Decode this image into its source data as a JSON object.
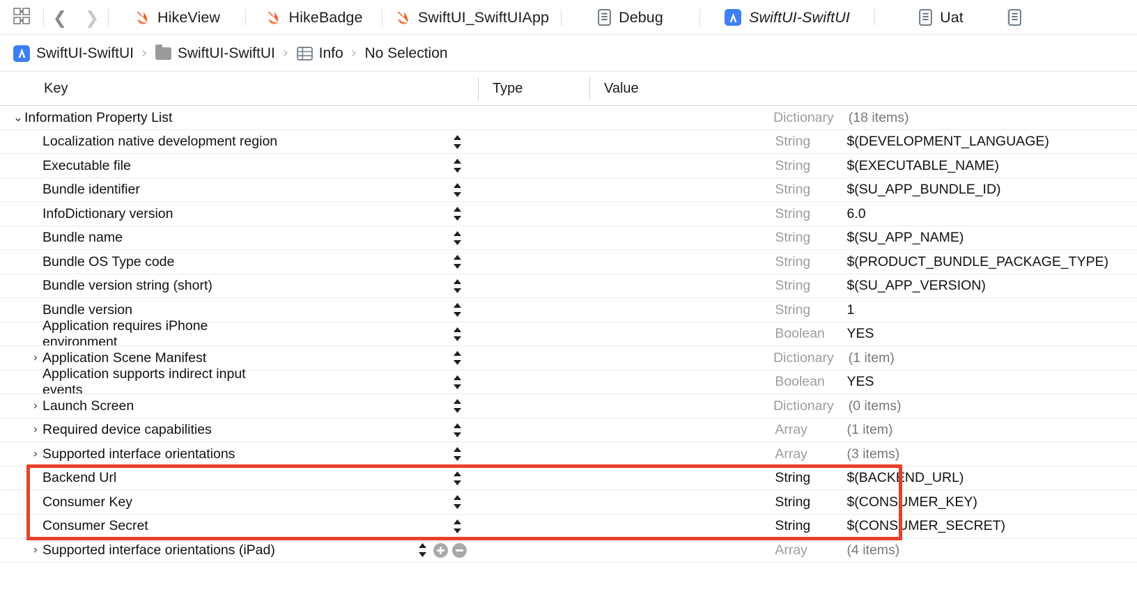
{
  "window": {
    "app": "Xcode",
    "accent_red": "#e8402a",
    "accent_blue": "#3e7ef7",
    "swift_orange": "#f05a28"
  },
  "tabbar": {
    "grid_icon": "grid-view-icon",
    "back_icon": "chevron-left-icon",
    "forward_icon": "chevron-right-icon",
    "tabs": [
      {
        "label": "HikeView",
        "icon": "swift-file-icon",
        "active": false,
        "italic": false
      },
      {
        "label": "HikeBadge",
        "icon": "swift-file-icon",
        "active": false,
        "italic": false
      },
      {
        "label": "SwiftUI_SwiftUIApp",
        "icon": "swift-file-icon",
        "active": false,
        "italic": false
      },
      {
        "label": "Debug",
        "icon": "plist-file-icon",
        "active": false,
        "italic": false
      },
      {
        "label": "SwiftUI-SwiftUI",
        "icon": "xcode-project-icon",
        "active": true,
        "italic": true
      },
      {
        "label": "Uat",
        "icon": "plist-file-icon",
        "active": false,
        "italic": false
      }
    ]
  },
  "breadcrumb": {
    "items": [
      {
        "label": "SwiftUI-SwiftUI",
        "icon": "xcode-project-icon"
      },
      {
        "label": "SwiftUI-SwiftUI",
        "icon": "folder-icon"
      },
      {
        "label": "Info",
        "icon": "plist-table-icon"
      },
      {
        "label": "No Selection",
        "icon": "none"
      }
    ],
    "separator": "›"
  },
  "table": {
    "columns": {
      "key": "Key",
      "type": "Type",
      "value": "Value"
    },
    "rows": [
      {
        "key": "Information Property List",
        "type": "Dictionary",
        "value": "(18 items)",
        "level": 0,
        "disclosure": "expanded",
        "type_dark": false,
        "value_muted": true,
        "stepper": false,
        "plusminus": false,
        "highlighted": false
      },
      {
        "key": "Localization native development region",
        "type": "String",
        "value": "$(DEVELOPMENT_LANGUAGE)",
        "level": 1,
        "disclosure": "none",
        "type_dark": false,
        "value_muted": false,
        "stepper": true,
        "plusminus": false,
        "highlighted": false
      },
      {
        "key": "Executable file",
        "type": "String",
        "value": "$(EXECUTABLE_NAME)",
        "level": 1,
        "disclosure": "none",
        "type_dark": false,
        "value_muted": false,
        "stepper": true,
        "plusminus": false,
        "highlighted": false
      },
      {
        "key": "Bundle identifier",
        "type": "String",
        "value": "$(SU_APP_BUNDLE_ID)",
        "level": 1,
        "disclosure": "none",
        "type_dark": false,
        "value_muted": false,
        "stepper": true,
        "plusminus": false,
        "highlighted": false
      },
      {
        "key": "InfoDictionary version",
        "type": "String",
        "value": "6.0",
        "level": 1,
        "disclosure": "none",
        "type_dark": false,
        "value_muted": false,
        "stepper": true,
        "plusminus": false,
        "highlighted": false
      },
      {
        "key": "Bundle name",
        "type": "String",
        "value": "$(SU_APP_NAME)",
        "level": 1,
        "disclosure": "none",
        "type_dark": false,
        "value_muted": false,
        "stepper": true,
        "plusminus": false,
        "highlighted": false
      },
      {
        "key": "Bundle OS Type code",
        "type": "String",
        "value": "$(PRODUCT_BUNDLE_PACKAGE_TYPE)",
        "level": 1,
        "disclosure": "none",
        "type_dark": false,
        "value_muted": false,
        "stepper": true,
        "plusminus": false,
        "highlighted": false
      },
      {
        "key": "Bundle version string (short)",
        "type": "String",
        "value": "$(SU_APP_VERSION)",
        "level": 1,
        "disclosure": "none",
        "type_dark": false,
        "value_muted": false,
        "stepper": true,
        "plusminus": false,
        "highlighted": false
      },
      {
        "key": "Bundle version",
        "type": "String",
        "value": "1",
        "level": 1,
        "disclosure": "none",
        "type_dark": false,
        "value_muted": false,
        "stepper": true,
        "plusminus": false,
        "highlighted": false
      },
      {
        "key": "Application requires iPhone environment",
        "type": "Boolean",
        "value": "YES",
        "level": 1,
        "disclosure": "none",
        "type_dark": false,
        "value_muted": false,
        "stepper": true,
        "plusminus": false,
        "highlighted": false
      },
      {
        "key": "Application Scene Manifest",
        "type": "Dictionary",
        "value": "(1 item)",
        "level": 1,
        "disclosure": "collapsed",
        "type_dark": false,
        "value_muted": true,
        "stepper": true,
        "plusminus": false,
        "highlighted": false
      },
      {
        "key": "Application supports indirect input events",
        "type": "Boolean",
        "value": "YES",
        "level": 1,
        "disclosure": "none",
        "type_dark": false,
        "value_muted": false,
        "stepper": true,
        "plusminus": false,
        "highlighted": false
      },
      {
        "key": "Launch Screen",
        "type": "Dictionary",
        "value": "(0 items)",
        "level": 1,
        "disclosure": "collapsed",
        "type_dark": false,
        "value_muted": true,
        "stepper": true,
        "plusminus": false,
        "highlighted": false
      },
      {
        "key": "Required device capabilities",
        "type": "Array",
        "value": "(1 item)",
        "level": 1,
        "disclosure": "collapsed",
        "type_dark": false,
        "value_muted": true,
        "stepper": true,
        "plusminus": false,
        "highlighted": false
      },
      {
        "key": "Supported interface orientations",
        "type": "Array",
        "value": "(3 items)",
        "level": 1,
        "disclosure": "collapsed",
        "type_dark": false,
        "value_muted": true,
        "stepper": true,
        "plusminus": false,
        "highlighted": false
      },
      {
        "key": "Backend Url",
        "type": "String",
        "value": "$(BACKEND_URL)",
        "level": 1,
        "disclosure": "none",
        "type_dark": true,
        "value_muted": false,
        "stepper": true,
        "plusminus": false,
        "highlighted": true
      },
      {
        "key": "Consumer Key",
        "type": "String",
        "value": "$(CONSUMER_KEY)",
        "level": 1,
        "disclosure": "none",
        "type_dark": true,
        "value_muted": false,
        "stepper": true,
        "plusminus": false,
        "highlighted": true
      },
      {
        "key": "Consumer Secret",
        "type": "String",
        "value": "$(CONSUMER_SECRET)",
        "level": 1,
        "disclosure": "none",
        "type_dark": true,
        "value_muted": false,
        "stepper": true,
        "plusminus": false,
        "highlighted": true
      },
      {
        "key": "Supported interface orientations (iPad)",
        "type": "Array",
        "value": "(4 items)",
        "level": 1,
        "disclosure": "collapsed",
        "type_dark": false,
        "value_muted": true,
        "stepper": true,
        "plusminus": true,
        "highlighted": false
      }
    ],
    "glyphs": {
      "expanded": "⌄",
      "collapsed": "›",
      "stepper": "stepper-updown-icon",
      "add": "add-row-icon",
      "remove": "remove-row-icon"
    }
  }
}
